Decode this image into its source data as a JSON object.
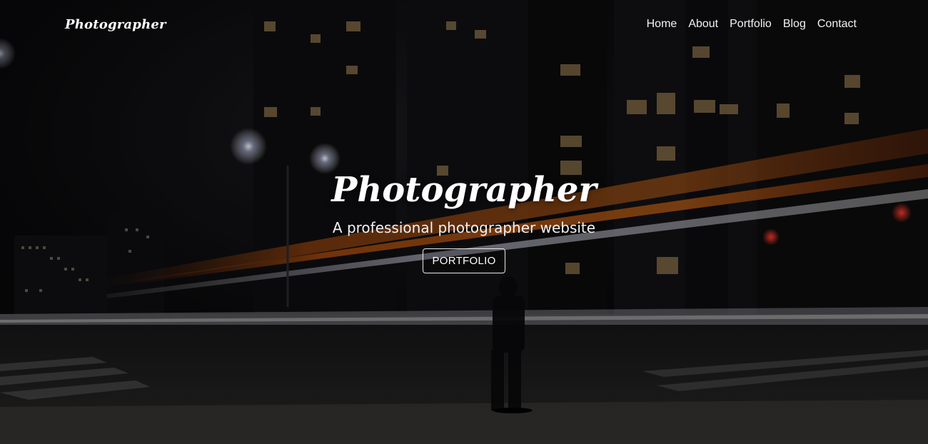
{
  "brand": {
    "name": "Photographer"
  },
  "nav": {
    "items": [
      "Home",
      "About",
      "Portfolio",
      "Blog",
      "Contact"
    ]
  },
  "hero": {
    "title": "Photographer",
    "subtitle": "A professional photographer website",
    "button_label": "PORTFOLIO",
    "image": "night-city-street-light-trails"
  }
}
